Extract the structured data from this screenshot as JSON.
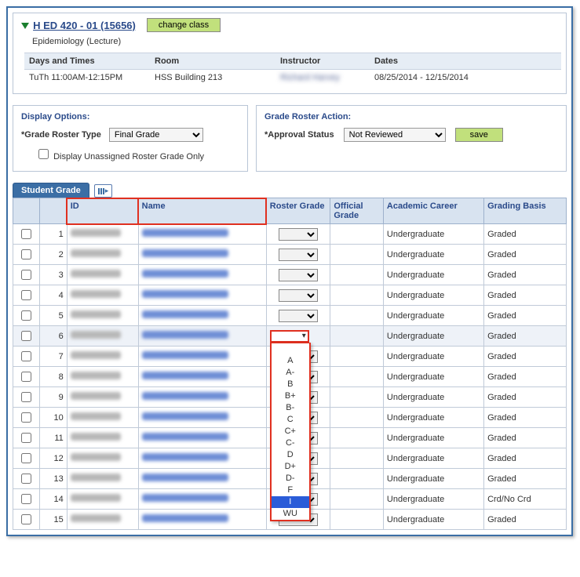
{
  "class": {
    "link_text": "H ED 420 - 01 (15656)",
    "change_btn": "change class",
    "subtitle": "Epidemiology (Lecture)",
    "headers": {
      "days": "Days and Times",
      "room": "Room",
      "instructor": "Instructor",
      "dates": "Dates"
    },
    "days": "TuTh 11:00AM-12:15PM",
    "room": "HSS Building 213",
    "instructor": "Richard Harvey",
    "dates": "08/25/2014 - 12/15/2014"
  },
  "display": {
    "title": "Display Options:",
    "roster_type_label": "*Grade Roster Type",
    "roster_type_value": "Final Grade",
    "unassigned_label": "Display Unassigned Roster Grade Only"
  },
  "action": {
    "title": "Grade Roster Action:",
    "status_label": "*Approval Status",
    "status_value": "Not Reviewed",
    "save_label": "save"
  },
  "tab": {
    "label": "Student Grade"
  },
  "columns": {
    "id": "ID",
    "name": "Name",
    "roster_grade": "Roster Grade",
    "official_grade": "Official Grade",
    "career": "Academic Career",
    "basis": "Grading Basis"
  },
  "grade_options": [
    "A",
    "A-",
    "B",
    "B+",
    "B-",
    "C",
    "C+",
    "C-",
    "D",
    "D+",
    "D-",
    "F",
    "I",
    "WU"
  ],
  "selected_grade": "I",
  "open_row_index": 6,
  "rows": [
    {
      "n": 1,
      "career": "Undergraduate",
      "basis": "Graded"
    },
    {
      "n": 2,
      "career": "Undergraduate",
      "basis": "Graded"
    },
    {
      "n": 3,
      "career": "Undergraduate",
      "basis": "Graded"
    },
    {
      "n": 4,
      "career": "Undergraduate",
      "basis": "Graded"
    },
    {
      "n": 5,
      "career": "Undergraduate",
      "basis": "Graded"
    },
    {
      "n": 6,
      "career": "Undergraduate",
      "basis": "Graded"
    },
    {
      "n": 7,
      "career": "Undergraduate",
      "basis": "Graded"
    },
    {
      "n": 8,
      "career": "Undergraduate",
      "basis": "Graded"
    },
    {
      "n": 9,
      "career": "Undergraduate",
      "basis": "Graded"
    },
    {
      "n": 10,
      "career": "Undergraduate",
      "basis": "Graded"
    },
    {
      "n": 11,
      "career": "Undergraduate",
      "basis": "Graded"
    },
    {
      "n": 12,
      "career": "Undergraduate",
      "basis": "Graded"
    },
    {
      "n": 13,
      "career": "Undergraduate",
      "basis": "Graded"
    },
    {
      "n": 14,
      "career": "Undergraduate",
      "basis": "Crd/No Crd"
    },
    {
      "n": 15,
      "career": "Undergraduate",
      "basis": "Graded"
    }
  ]
}
